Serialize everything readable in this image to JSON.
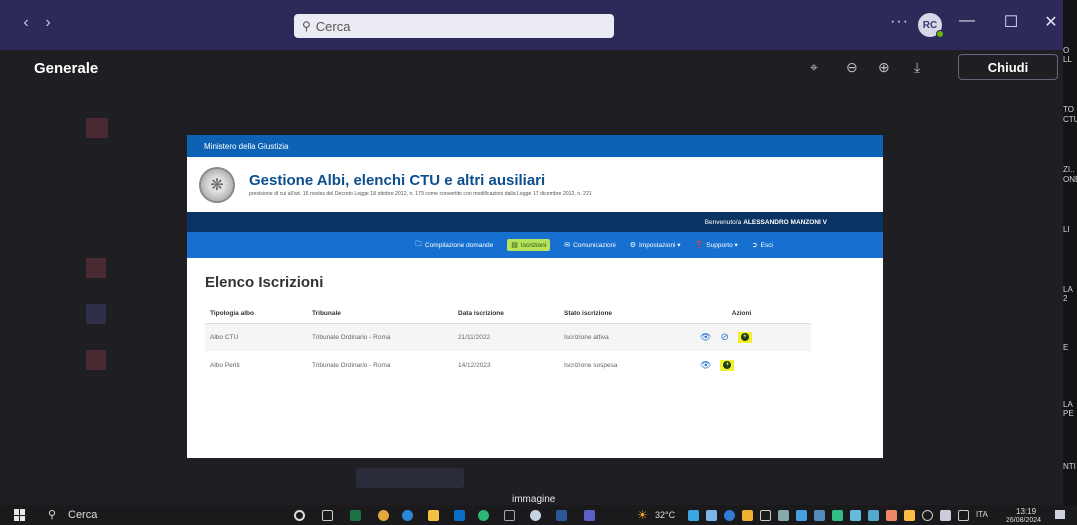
{
  "app": {
    "search_placeholder": "Cerca",
    "avatar_initials": "RC",
    "more_glyph": "···"
  },
  "viewer": {
    "title": "Generale",
    "close_label": "Chiudi",
    "caption": "immagine"
  },
  "document": {
    "ministry": "Ministero della Giustizia",
    "title": "Gestione Albi, elenchi CTU e altri ausiliari",
    "subtitle": "previsione di cui all'art. 16 novies del Decreto Legge 18 ottobre 2012, n. 179 come convertito con modificazioni dalla Legge 17 dicembre 2012, n. 221",
    "welcome_prefix": "Benvenuto/a",
    "welcome_user": "ALESSANDRO MANZONI V",
    "menu": [
      {
        "label": "Compilazione domande",
        "icon": "folder-icon"
      },
      {
        "label": "Iscrizioni",
        "icon": "list-icon"
      },
      {
        "label": "Comunicazioni",
        "icon": "envelope-icon"
      },
      {
        "label": "Impostazioni ▾",
        "icon": "gear-icon"
      },
      {
        "label": "Supporto ▾",
        "icon": "question-icon"
      },
      {
        "label": "Esci",
        "icon": "exit-icon"
      }
    ],
    "section_title": "Elenco Iscrizioni",
    "table": {
      "headers": [
        "Tipologia albo",
        "Tribunale",
        "Data iscrizione",
        "Stato iscrizione",
        "Azioni"
      ],
      "rows": [
        {
          "albo": "Albo CTU",
          "tribunale": "Tribunale Ordinario - Roma",
          "data": "21/11/2022",
          "stato": "Iscrizione attiva"
        },
        {
          "albo": "Albo Periti",
          "tribunale": "Tribunale Ordinario - Roma",
          "data": "14/12/2023",
          "stato": "Iscrizione sospesa"
        }
      ]
    }
  },
  "right_strip": [
    "O",
    "LL",
    "TO",
    "CTU",
    "ZI..",
    "ONE",
    "LI",
    "LA",
    "2",
    "E",
    "LA",
    "PE",
    "NTI"
  ],
  "taskbar": {
    "search_label": "Cerca",
    "temperature": "32°C",
    "language": "ITA",
    "time": "13:19",
    "date": "26/08/2024"
  },
  "colors": {
    "titlebar": "#2d2a59",
    "doc_blue": "#0e62b5",
    "doc_navy": "#0b3363",
    "highlight_yellow": "#f2f02c",
    "active_green": "#b7e35a"
  }
}
